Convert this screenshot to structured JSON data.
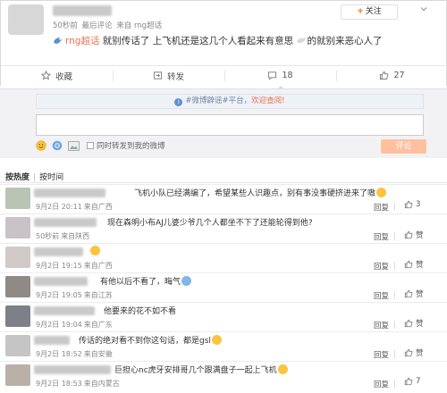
{
  "post": {
    "meta": {
      "time": "50秒前",
      "last_comment": "最后评论",
      "source": "来自 rng超话"
    },
    "follow_label": "关注",
    "topic_link": "rng超话",
    "content": "就别传话了 上飞机还是这几个人看起来有意思 ",
    "content_tail": "的就别来恶心人了"
  },
  "actions": {
    "collect": "收藏",
    "repost": "转发",
    "comment": "18",
    "like": "27"
  },
  "comment_box": {
    "notice_prefix": "#微博辟谣#平台，",
    "notice_link": "欢迎查阅!",
    "repost_label": "同时转发到我的微博",
    "submit_label": "评论"
  },
  "sort": {
    "hot": "按热度",
    "time": "按时间"
  },
  "comments": [
    {
      "text": "飞机小队已经满编了，希望某些人识趣点，别有事没事硬挤进来了嗷",
      "time": "9月2日 20:11",
      "source": "来自广西",
      "reply": "回复",
      "likes": "3",
      "emoji": "smile"
    },
    {
      "text": "现在森明小布AJ儿婆少爷几个人都坐不下了还能轮得到他?",
      "time": "50秒前",
      "source": "来自陕西",
      "reply": "回复",
      "likes": "赞",
      "emoji": ""
    },
    {
      "text": "",
      "time": "9月2日 19:15",
      "source": "来自广西",
      "reply": "回复",
      "likes": "赞",
      "emoji": "grin"
    },
    {
      "text": "有他以后不看了，晦气",
      "time": "9月2日 19:05",
      "source": "来自江苏",
      "reply": "回复",
      "likes": "赞",
      "emoji": "mask"
    },
    {
      "text": "他要来的花不如不看",
      "time": "9月2日 19:04",
      "source": "来自广东",
      "reply": "回复",
      "likes": "赞",
      "emoji": ""
    },
    {
      "text": "传话的绝对看不到你这句话，都是gsl",
      "time": "9月2日 18:52",
      "source": "来自安徽",
      "reply": "回复",
      "likes": "赞",
      "emoji": "wink"
    },
    {
      "text": "巨担心nc虎牙安排哥几个跟满盘子一起上飞机",
      "time": "9月2日 18:53",
      "source": "来自内蒙古",
      "reply": "回复",
      "likes": "7",
      "emoji": "tears"
    }
  ],
  "colors": {
    "accent": "#eb7350",
    "link_blue": "#5d8fd0",
    "submit_bg": "#ffc09f"
  }
}
